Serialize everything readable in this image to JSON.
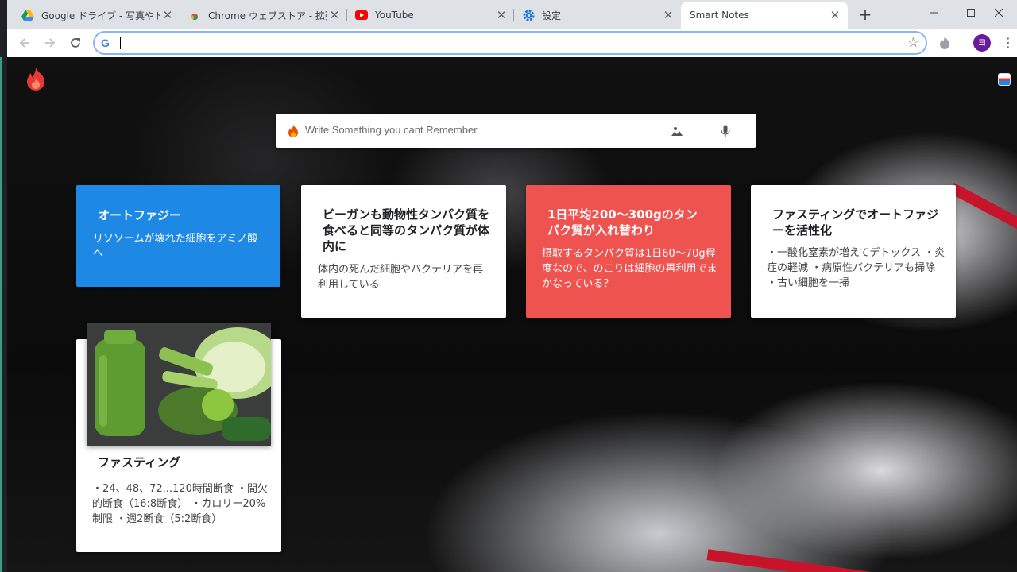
{
  "browser": {
    "tabs": [
      {
        "title": "Google ドライブ - 写真やドキュ",
        "icon": "google-drive-icon"
      },
      {
        "title": "Chrome ウェブストア - 拡張機",
        "icon": "chrome-webstore-icon"
      },
      {
        "title": "YouTube",
        "icon": "youtube-icon"
      },
      {
        "title": "設定",
        "icon": "settings-gear-icon"
      },
      {
        "title": "Smart Notes",
        "icon": "none",
        "active": true
      }
    ],
    "new_tab_label": "+",
    "address_value": "",
    "avatar_letter": "ヨ"
  },
  "search": {
    "placeholder": "Write Something you cant Remember"
  },
  "notes": [
    {
      "title": "オートファジー",
      "body": "リソソームが壊れた細胞をアミノ酸へ",
      "color": "#1e88e5"
    },
    {
      "title": "ビーガンも動物性タンパク質を食べると同等のタンパク質が体内に",
      "body": "体内の死んだ細胞やバクテリアを再利用している",
      "color": "#ffffff"
    },
    {
      "title": "1日平均200〜300gのタンパク質が入れ替わり",
      "body": "摂取するタンパク質は1日60〜70g程度なので、のこりは細胞の再利用でまかなっている？",
      "color": "#ef5350"
    },
    {
      "title": "ファスティングでオートファジーを活性化",
      "body": "・一酸化窒素が増えてデトックス ・炎症の軽減 ・病原性バクテリアも掃除 ・古い細胞を一掃",
      "color": "#ffffff"
    },
    {
      "title": "ファスティング",
      "body": "・24、48、72...120時間断食 ・間欠的断食（16:8断食） ・カロリー20%制限 ・週2断食（5:2断食）",
      "color": "#ffffff",
      "image": "green-smoothie-vegetables-photo"
    }
  ]
}
